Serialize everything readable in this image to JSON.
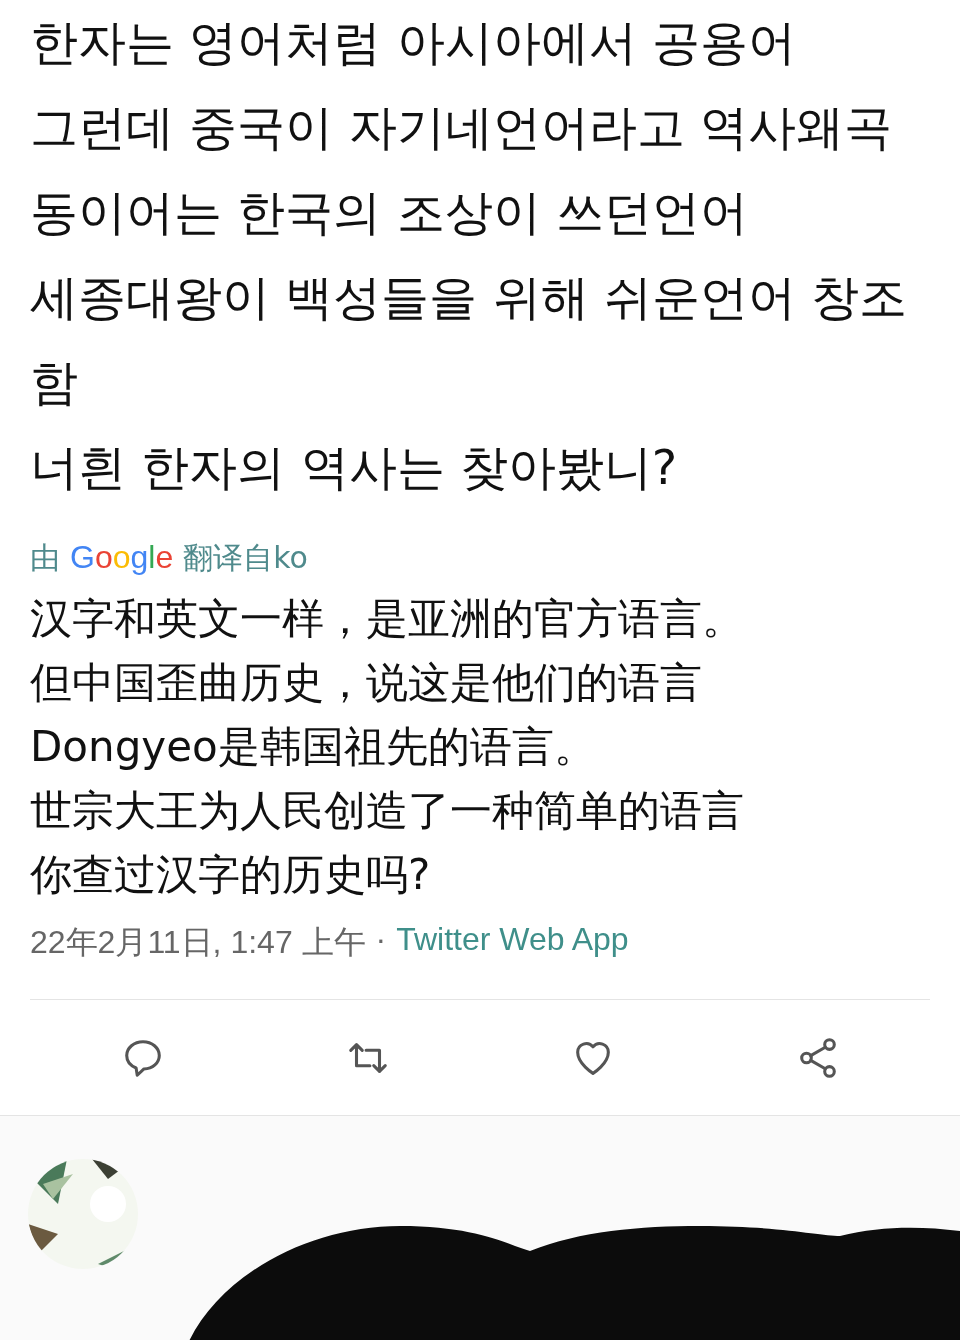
{
  "tweet": {
    "text_lines": [
      "한자는 영어처럼 아시아에서 공용어",
      "그런데 중국이 자기네언어라고 역사왜곡",
      "동이어는 한국의 조상이 쓰던언어",
      "세종대왕이 백성들을 위해 쉬운언어 창조함",
      "너흰 한자의 역사는 찾아봤니?"
    ],
    "translation": {
      "prefix": "由",
      "provider": "Google",
      "suffix": "翻译自ko"
    },
    "translated_lines": [
      "汉字和英文一样，是亚洲的官方语言。",
      "但中国歪曲历史，说这是他们的语言",
      "Dongyeo是韩国祖先的语言。",
      "世宗大王为人民创造了一种简单的语言",
      "你查过汉字的历史吗?"
    ],
    "timestamp": "22年2月11日, 1:47 上午",
    "separator": "·",
    "source": "Twitter Web App"
  },
  "actions": [
    {
      "kind": "reply"
    },
    {
      "kind": "retweet"
    },
    {
      "kind": "like"
    },
    {
      "kind": "share"
    }
  ],
  "reply": {
    "redacted": true
  }
}
